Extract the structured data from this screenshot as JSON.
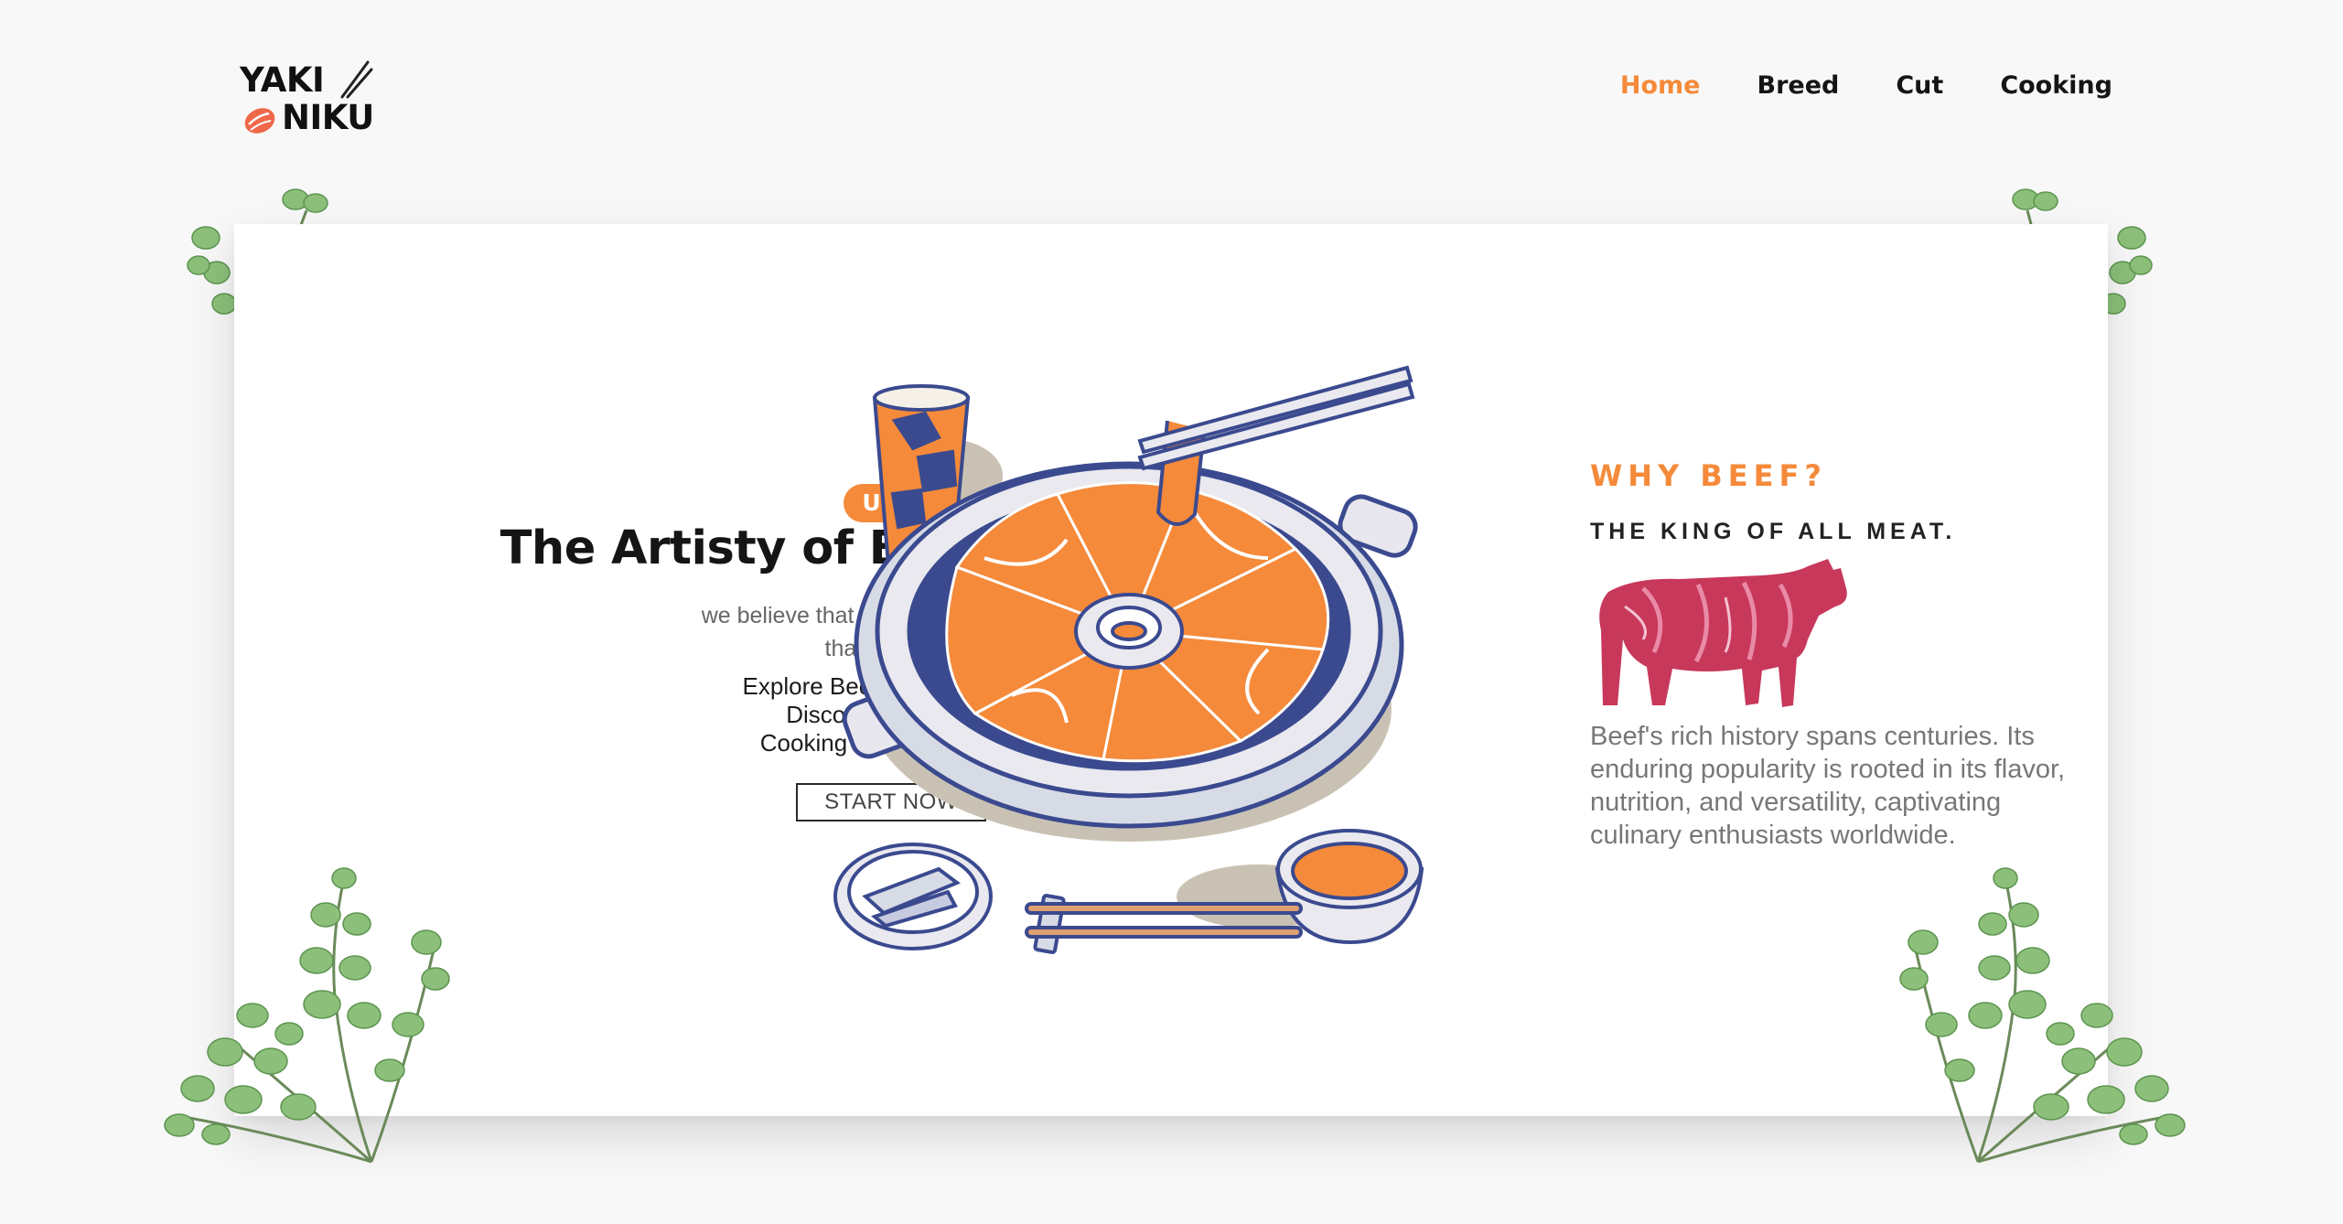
{
  "brand": {
    "line1": "YAKI",
    "line2": "NIKU"
  },
  "nav": {
    "items": [
      {
        "label": "Home",
        "active": true
      },
      {
        "label": "Breed",
        "active": false
      },
      {
        "label": "Cut",
        "active": false
      },
      {
        "label": "Cooking",
        "active": false
      }
    ]
  },
  "hero": {
    "badge": "UNLOCK",
    "title": "The Artisty of Beef",
    "subtitle": "we believe that beef is more than just a meal",
    "features": [
      "Explore Beef Breeds",
      "Discover Unique",
      "Cooking Techiques"
    ],
    "cta": "START NOW"
  },
  "aside": {
    "heading": "WHY BEEF?",
    "subheading": "THE KING OF ALL MEAT.",
    "description": "Beef's rich history spans centuries. Its enduring popularity is rooted in its flavor, nutrition, and versatility, captivating culinary enthusiasts worldwide."
  },
  "colors": {
    "accent": "#f58a3a",
    "navy": "#3b4a8f",
    "leaf": "#8cc07a",
    "meat": "#c8385a"
  },
  "icons": [
    "chopsticks-icon",
    "meat-icon",
    "radio-dot-icon",
    "eucalyptus-leaves",
    "grill-illustration",
    "cow-illustration"
  ]
}
